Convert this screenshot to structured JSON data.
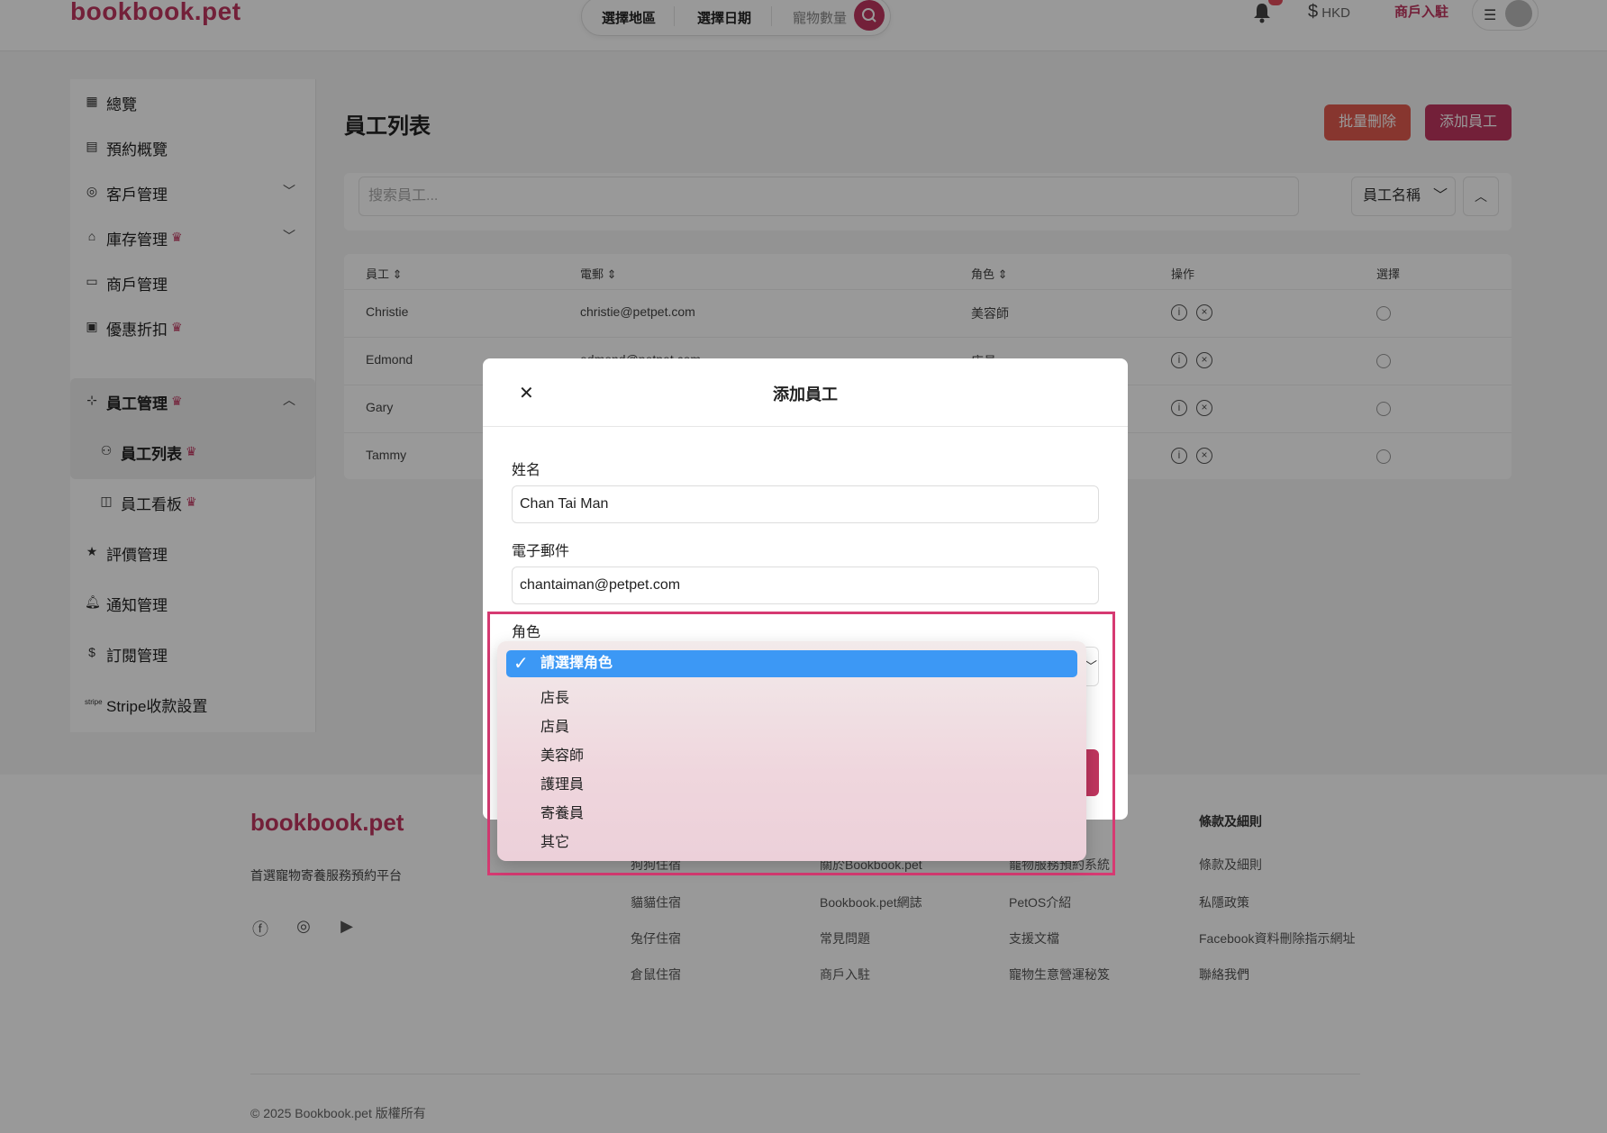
{
  "header": {
    "logo": "bookbook.pet",
    "search_region": "選擇地區",
    "search_date": "選擇日期",
    "search_pets": "寵物數量",
    "currency": "HKD",
    "merchant_join": "商戶入駐"
  },
  "sidebar": {
    "items": [
      {
        "label": "總覽",
        "icon": "dashboard-icon"
      },
      {
        "label": "預約概覽",
        "icon": "calendar-icon"
      },
      {
        "label": "客戶管理",
        "icon": "headset-icon"
      },
      {
        "label": "庫存管理",
        "icon": "warehouse-icon"
      },
      {
        "label": "商戶管理",
        "icon": "store-icon"
      },
      {
        "label": "優惠折扣",
        "icon": "ticket-icon"
      },
      {
        "label": "員工管理",
        "icon": "org-icon"
      },
      {
        "label": "員工列表",
        "icon": "people-icon"
      },
      {
        "label": "員工看板",
        "icon": "kanban-icon"
      },
      {
        "label": "評價管理",
        "icon": "star-icon"
      },
      {
        "label": "通知管理",
        "icon": "bell-icon"
      },
      {
        "label": "訂閱管理",
        "icon": "dollar-icon"
      },
      {
        "label": "Stripe收款設置",
        "icon": "stripe-icon"
      }
    ]
  },
  "main": {
    "title": "員工列表",
    "bulk_delete": "批量刪除",
    "add_staff": "添加員工",
    "search_placeholder": "搜索員工...",
    "sort_field": "員工名稱",
    "table": {
      "headers": [
        "員工",
        "電郵",
        "角色",
        "操作",
        "選擇"
      ],
      "rows": [
        {
          "name": "Christie",
          "email": "christie@petpet.com",
          "role": "美容師"
        },
        {
          "name": "Edmond",
          "email": "edmond@petpet.com",
          "role": "店員"
        },
        {
          "name": "Gary",
          "email": "",
          "role": ""
        },
        {
          "name": "Tammy",
          "email": "",
          "role": ""
        }
      ]
    }
  },
  "footer": {
    "logo": "bookbook.pet",
    "tagline": "首選寵物寄養服務預約平台",
    "col1": [
      "狗狗住宿",
      "貓貓住宿",
      "兔仔住宿",
      "倉鼠住宿"
    ],
    "col2": [
      "關於Bookbook.pet",
      "Bookbook.pet網誌",
      "常見問題",
      "商戶入駐"
    ],
    "col3": [
      "寵物服務預約系統",
      "PetOS介紹",
      "支援文檔",
      "寵物生意營運秘笈"
    ],
    "col4_title": "條款及細則",
    "col4": [
      "條款及細則",
      "私隱政策",
      "Facebook資料刪除指示網址",
      "聯絡我們"
    ],
    "copyright": "© 2025 Bookbook.pet 版權所有"
  },
  "modal": {
    "title": "添加員工",
    "name_label": "姓名",
    "name_value": "Chan Tai Man",
    "email_label": "電子郵件",
    "email_value": "chantaiman@petpet.com",
    "role_label": "角色",
    "role_options": [
      "請選擇角色",
      "店長",
      "店員",
      "美容師",
      "護理員",
      "寄養員",
      "其它"
    ],
    "role_selected": "請選擇角色"
  },
  "colors": {
    "brand": "#c0365f",
    "delete": "#e15a4f",
    "selected_option": "#3c98f5"
  }
}
